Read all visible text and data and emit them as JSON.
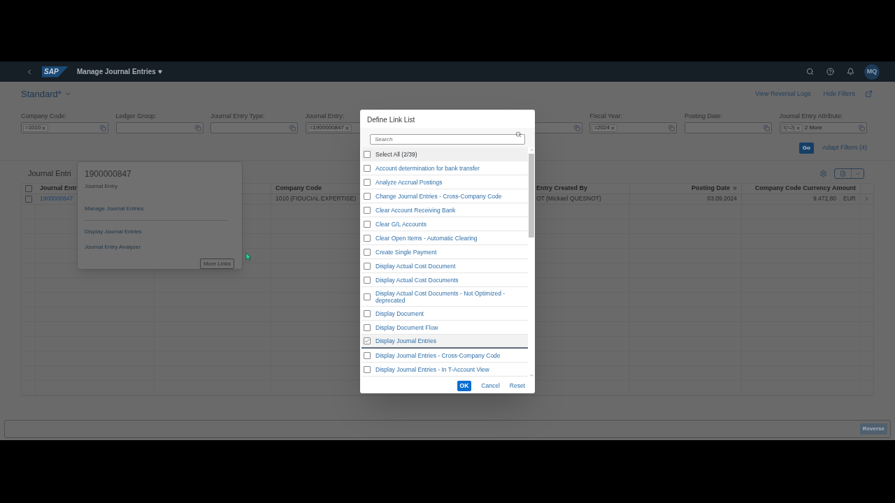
{
  "shell": {
    "logo": "SAP",
    "title": "Manage Journal Entries",
    "avatar": "MQ"
  },
  "header": {
    "variant": "Standard",
    "variant_modified_mark": "*",
    "actions": [
      "View Reversal Logs",
      "Hide Filters"
    ]
  },
  "filters": [
    {
      "label": "Company Code:",
      "tokens": [
        "=1010"
      ]
    },
    {
      "label": "Ledger Group:"
    },
    {
      "label": "Journal Entry Type:"
    },
    {
      "label": "Journal Entry:",
      "tokens": [
        "=1900000847"
      ]
    },
    {
      "label": "Fiscal Year:",
      "tokens": [
        "=2024"
      ]
    },
    {
      "label": "Posting Date:"
    },
    {
      "label": "Journal Entry Attribute:",
      "tokens": [
        "!(=J)"
      ],
      "more": "2 More"
    }
  ],
  "filter_bar": {
    "go": "Go",
    "adapt": "Adapt Filters (4)"
  },
  "table": {
    "title": "Journal Entri",
    "select_all_checked": false,
    "columns": [
      {
        "header": "Journal Entr",
        "sorted": false
      },
      {
        "header": "Company Code",
        "sorted": false
      },
      {
        "header": "Entry Created By",
        "sorted": false
      },
      {
        "header": "Posting Date",
        "sorted": true
      },
      {
        "header": "Company Code Currency Amount",
        "sorted": false
      }
    ],
    "rows": [
      {
        "cells": [
          "1900000847",
          "1010 (FIDUCIAL EXPERTISE)",
          "OT (Mickael QUESNOT)",
          "03.09.2024",
          "9.472,80"
        ],
        "currency": "EUR",
        "selected": false
      }
    ]
  },
  "popover": {
    "title": "1900000847",
    "subtitle": "Journal Entry",
    "main_link": "Manage Journal Entries",
    "links": [
      "Display Journal Entries",
      "Journal Entry Analyzer"
    ],
    "button": "More Links"
  },
  "footer": {
    "button": "Reverse",
    "disabled": true
  },
  "dialog": {
    "title": "Define Link List",
    "search_placeholder": "Search",
    "items": [
      {
        "kind": "all",
        "label": "Select All (2/39)",
        "checked": false
      },
      {
        "kind": "link",
        "label": "Account determination for bank transfer",
        "checked": false
      },
      {
        "kind": "link",
        "label": "Analyze Accrual Postings",
        "checked": false
      },
      {
        "kind": "link",
        "label": "Change Journal Entries - Cross-Company Code",
        "checked": false
      },
      {
        "kind": "link",
        "label": "Clear Account Receiving Bank",
        "checked": false
      },
      {
        "kind": "link",
        "label": "Clear G/L Accounts",
        "checked": false
      },
      {
        "kind": "link",
        "label": "Clear Open Items - Automatic Clearing",
        "checked": false
      },
      {
        "kind": "link",
        "label": "Create Single Payment",
        "checked": false
      },
      {
        "kind": "link",
        "label": "Display Actual Cost Document",
        "checked": false
      },
      {
        "kind": "link",
        "label": "Display Actual Cost Documents",
        "checked": false
      },
      {
        "kind": "link",
        "label": "Display Actual Cost Documents - Not Optimized - deprecated",
        "checked": false
      },
      {
        "kind": "link",
        "label": "Display Document",
        "checked": false
      },
      {
        "kind": "link",
        "label": "Display Document Flow",
        "checked": false
      },
      {
        "kind": "link",
        "label": "Display Journal Entries",
        "checked": true
      },
      {
        "kind": "link",
        "label": "Display Journal Entries - Cross-Company Code",
        "checked": false
      },
      {
        "kind": "link",
        "label": "Display Journal Entries - In T-Account View",
        "checked": false
      }
    ],
    "buttons": [
      "OK",
      "Cancel",
      "Reset"
    ]
  }
}
